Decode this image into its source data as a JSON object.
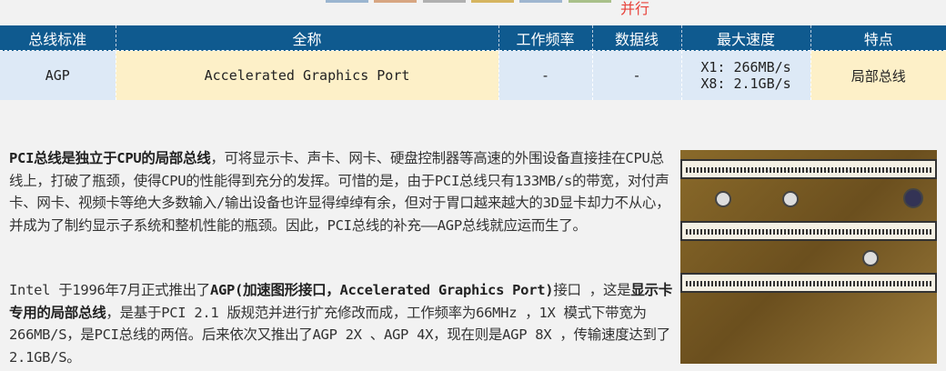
{
  "top_note": "并行",
  "tab_colors": [
    "#9bb5d0",
    "#d8a682",
    "#b0b0b0",
    "#d6b560",
    "#9fb6d0",
    "#a9c08a"
  ],
  "table": {
    "headers": [
      "总线标准",
      "全称",
      "工作频率",
      "数据线",
      "最大速度",
      "特点"
    ],
    "row": {
      "standard": "AGP",
      "full_name": "Accelerated Graphics Port",
      "frequency": "-",
      "data_lines": "-",
      "speed_x1": "X1: 266MB/s",
      "speed_x8": "X8: 2.1GB/s",
      "feature": "局部总线"
    }
  },
  "paragraph1": {
    "bold": "PCI总线是独立于CPU的局部总线",
    "text": "，可将显示卡、声卡、网卡、硬盘控制器等高速的外围设备直接挂在CPU总线上，打破了瓶颈，使得CPU的性能得到充分的发挥。可惜的是，由于PCI总线只有133MB/s的带宽，对付声卡、网卡、视频卡等绝大多数输入/输出设备也许显得绰绰有余，但对于胃口越来越大的3D显卡却力不从心，并成为了制约显示子系统和整机性能的瓶颈。因此，PCI总线的补充——AGP总线就应运而生了。"
  },
  "paragraph2": {
    "t1": "Intel 于1996年7月正式推出了",
    "b1": "AGP(加速图形接口，Accelerated Graphics Port)",
    "t2": "接口 ，这是",
    "b2": "显示卡专用的局部总线",
    "t3": "，是基于PCI 2.1 版规范并进行扩充修改而成，工作频率为66MHz ，1X 模式下带宽为266MB/S，是PCI总线的两倍。后来依次又推出了AGP 2X 、AGP 4X，现在则是AGP 8X ，传输速度达到了2.1GB/S。"
  }
}
